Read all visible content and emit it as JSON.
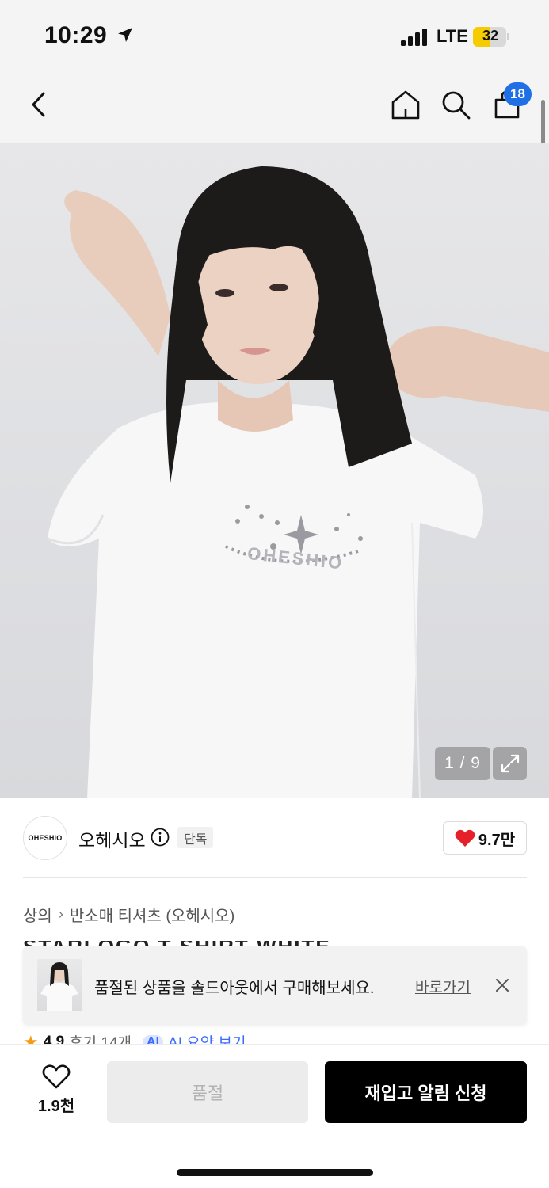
{
  "status_bar": {
    "time": "10:29",
    "network": "LTE",
    "battery": "32"
  },
  "nav": {
    "cart_count": "18",
    "icons": [
      "back-icon",
      "home-icon",
      "search-icon",
      "cart-icon"
    ]
  },
  "gallery": {
    "counter": "1 / 9",
    "shirt_print": "OHESHIO"
  },
  "brand": {
    "logo_text": "OHESHIO",
    "name": "오헤시오",
    "tag": "단독",
    "likes": "9.7만",
    "heart_color": "#e5202a"
  },
  "breadcrumb": {
    "category": "상의",
    "subcategory": "반소매 티셔츠 (오헤시오)"
  },
  "product": {
    "title": "STARLOGO T-SHIRT WHITE"
  },
  "toast": {
    "message": "품절된 상품을 솔드아웃에서 구매해보세요.",
    "link": "바로가기"
  },
  "review_peek": {
    "rating": "4.9",
    "reviews": "후기 14개",
    "ai_badge": "AI",
    "ai_label": "AI 요약 보기"
  },
  "bottom": {
    "wish_count": "1.9천",
    "soldout_label": "품절",
    "restock_label": "재입고 알림 신청"
  },
  "colors": {
    "accent_blue": "#1f6fe6",
    "ai_blue": "#3b6cff",
    "battery_yellow": "#f6cc00"
  }
}
